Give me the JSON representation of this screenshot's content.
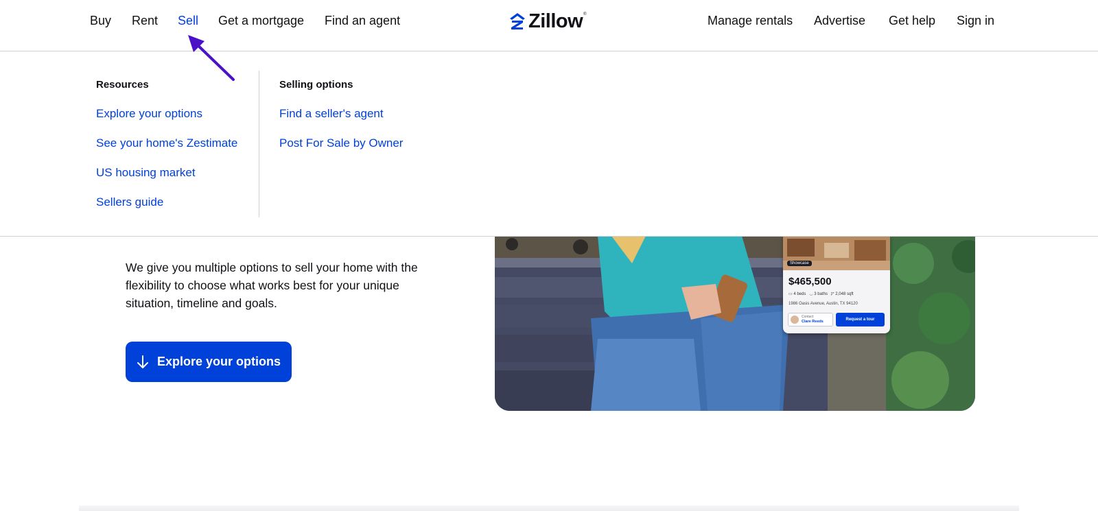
{
  "header": {
    "nav_left": [
      "Buy",
      "Rent",
      "Sell",
      "Get a mortgage",
      "Find an agent"
    ],
    "active": "Sell",
    "logo": "Zillow",
    "nav_right": [
      "Manage rentals",
      "Advertise",
      "Get help",
      "Sign in"
    ]
  },
  "dropdown": {
    "resources": {
      "heading": "Resources",
      "links": [
        "Explore your options",
        "See your home's Zestimate",
        "US housing market",
        "Sellers guide"
      ]
    },
    "selling_options": {
      "heading": "Selling options",
      "links": [
        "Find a seller's agent",
        "Post For Sale by Owner"
      ]
    }
  },
  "hero": {
    "text": "We give you multiple options to sell your home with the flexibility to choose what works best for your unique situation, timeline and goals.",
    "cta_label": "Explore your options",
    "cta_icon": "arrow-down-icon"
  },
  "listing_card": {
    "badge": "Showcase",
    "price": "$465,500",
    "beds": "4 beds",
    "baths": "3 baths",
    "sqft": "2,048 sqft",
    "address": "1986 Oasis Avenue, Austin, TX 94120",
    "contact_label": "Contact",
    "contact_name": "Clare Reeds",
    "tour_button": "Request a tour"
  },
  "colors": {
    "brand_blue": "#0041d9",
    "annotation_arrow": "#4a11c9",
    "text": "#111116",
    "divider": "#d1d1d5"
  }
}
